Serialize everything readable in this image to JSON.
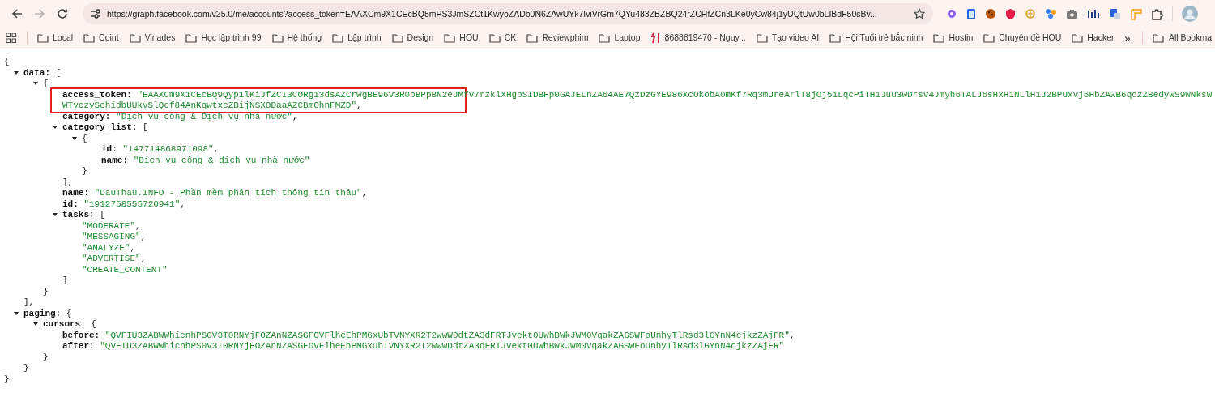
{
  "browser": {
    "url": "https://graph.facebook.com/v25.0/me/accounts?access_token=EAAXCm9X1CEcBQ5mPS3JmSZCt1KwyoZADb0N6ZAwUYk7IviVrGm7QYu483ZBZBQ24rZCHfZCn3LKe0yCw84j1yUQtUw0bLIBdF50sBv...",
    "forward_disabled": true,
    "bookmarks": [
      {
        "label": "Local",
        "kind": "folder"
      },
      {
        "label": "Coint",
        "kind": "folder"
      },
      {
        "label": "Vinades",
        "kind": "folder"
      },
      {
        "label": "Học lập trình 99",
        "kind": "folder"
      },
      {
        "label": "Hệ thống",
        "kind": "folder"
      },
      {
        "label": "Lập trình",
        "kind": "folder"
      },
      {
        "label": "Design",
        "kind": "folder"
      },
      {
        "label": "HOU",
        "kind": "folder"
      },
      {
        "label": "CK",
        "kind": "folder"
      },
      {
        "label": "Reviewphim",
        "kind": "folder"
      },
      {
        "label": "Laptop",
        "kind": "folder"
      },
      {
        "label": "8688819470 - Nguy...",
        "kind": "site"
      },
      {
        "label": "Tạo video AI",
        "kind": "folder"
      },
      {
        "label": "Hội Tuổi trẻ bắc ninh",
        "kind": "folder"
      },
      {
        "label": "Hostin",
        "kind": "folder"
      },
      {
        "label": "Chuyên đề HOU",
        "kind": "folder"
      },
      {
        "label": "Hacker",
        "kind": "folder"
      }
    ],
    "more": "»",
    "all_bookmarks": "All Bookma"
  },
  "viewer": {
    "root": {
      "open": "{",
      "close": "}",
      "children": [
        {
          "key": "data:",
          "open": "[",
          "close": "],",
          "expanded": true,
          "children": [
            {
              "open": "{",
              "close": "}",
              "expanded": true,
              "children": [
                {
                  "key": "access_token:",
                  "value": "\"EAAXCm9X1CEcBQ9Qyp1lKiJfZCI3CORg13dsAZCrwgBE96v3R0bBPpBN2eJMfV7rzklXHgbSIDBFp0GAJELnZA64AE7QzDzGYE986XcOkobA0mKf7Rq3mUreArlT8jOj51LqcPiTH1Juu3wDrsV4Jmyh6TALJ6sHxH1NLlH1J2BPUxvj6HbZAwB6qdzZBedyWS9WNksWWTvczvSehidbUUkvSlQef84AnKqwtxcZBijNSXODaaAZCBmOhnFMZD\"",
                  "comma": ",",
                  "highlighted": true
                },
                {
                  "key": "category:",
                  "value": "\"Dịch vụ công & Dịch vụ nhà nước\"",
                  "comma": ","
                },
                {
                  "key": "category_list:",
                  "open": "[",
                  "close": "],",
                  "expanded": true,
                  "children": [
                    {
                      "open": "{",
                      "close": "}",
                      "expanded": true,
                      "children": [
                        {
                          "key": "id:",
                          "value": "\"147714868971098\"",
                          "comma": ","
                        },
                        {
                          "key": "name:",
                          "value": "\"Dịch vụ công & dịch vụ nhà nước\""
                        }
                      ]
                    }
                  ]
                },
                {
                  "key": "name:",
                  "value": "\"DauThau.INFO - Phần mềm phân tích thông tin thầu\"",
                  "comma": ","
                },
                {
                  "key": "id:",
                  "value": "\"1912758555720941\"",
                  "comma": ","
                },
                {
                  "key": "tasks:",
                  "open": "[",
                  "close": "]",
                  "expanded": true,
                  "children": [
                    {
                      "value": "\"MODERATE\"",
                      "comma": ","
                    },
                    {
                      "value": "\"MESSAGING\"",
                      "comma": ","
                    },
                    {
                      "value": "\"ANALYZE\"",
                      "comma": ","
                    },
                    {
                      "value": "\"ADVERTISE\"",
                      "comma": ","
                    },
                    {
                      "value": "\"CREATE_CONTENT\""
                    }
                  ]
                }
              ]
            }
          ]
        },
        {
          "key": "paging:",
          "open": "{",
          "close": "}",
          "expanded": true,
          "children": [
            {
              "key": "cursors:",
              "open": "{",
              "close": "}",
              "expanded": true,
              "children": [
                {
                  "key": "before:",
                  "value": "\"QVFIU3ZABWWhicnhPS0V3T0RNYjFOZAnNZASGFOVFlheEhPMGxUbTVNYXR2T2wwWDdtZA3dFRTJvekt0UWhBWkJWM0VqakZAGSWFoUnhyTlRsd3lGYnN4cjkzZAjFR\"",
                  "comma": ","
                },
                {
                  "key": "after:",
                  "value": "\"QVFIU3ZABWWhicnhPS0V3T0RNYjFOZAnNZASGFOVFlheEhPMGxUbTVNYXR2T2wwWDdtZA3dFRTJvekt0UWhBWkJWM0VqakZAGSWFoUnhyTlRsd3lGYnN4cjkzZAjFR\""
                }
              ]
            }
          ]
        }
      ]
    }
  }
}
